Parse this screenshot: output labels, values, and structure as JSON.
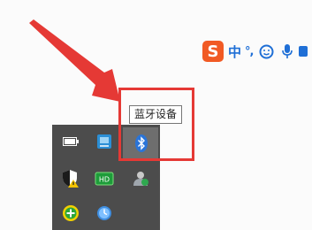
{
  "ime_toolbar": {
    "logo_letter": "S",
    "mode_label": "中",
    "punct_label": "°,",
    "icons": [
      "emoji-icon",
      "microphone-icon",
      "more-icon"
    ],
    "brand_color": "#f15a24",
    "accent_color": "#1f6fd6"
  },
  "tray": {
    "icons": [
      {
        "name": "battery-icon"
      },
      {
        "name": "network-manager-icon"
      },
      {
        "name": "bluetooth-icon"
      },
      {
        "name": "security-shield-warning-icon"
      },
      {
        "name": "device-card-icon"
      },
      {
        "name": "user-sync-icon"
      },
      {
        "name": "green-plus-icon"
      },
      {
        "name": "clock-icon"
      }
    ],
    "card_label": "HD"
  },
  "tooltip": {
    "text": "蓝牙设备"
  },
  "annotation": {
    "color": "#e53935"
  }
}
